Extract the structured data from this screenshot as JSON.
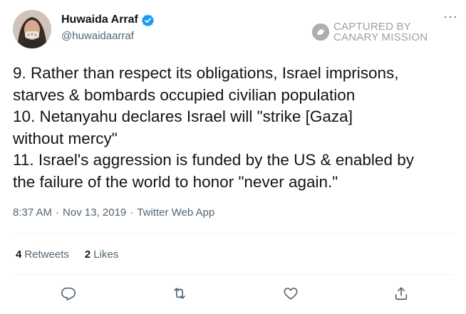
{
  "author": {
    "display_name": "Huwaida Arraf",
    "handle": "@huwaidaarraf",
    "verified": true
  },
  "more_label": "···",
  "watermark": {
    "line1": "CAPTURED BY",
    "line2": "CANARY MISSION"
  },
  "tweet": {
    "lines": [
      "9. Rather than respect its obligations, Israel imprisons,",
      "starves & bombards occupied civilian population",
      "10. Netanyahu declares Israel will \"strike [Gaza]",
      "without mercy\"",
      "11. Israel's aggression is funded by the US & enabled by",
      "the failure of the world to honor \"never again.\""
    ]
  },
  "meta": {
    "time": "8:37 AM",
    "sep1": "·",
    "date": "Nov 13, 2019",
    "sep2": "·",
    "source": "Twitter Web App"
  },
  "stats": {
    "retweets_count": "4",
    "retweets_label": "Retweets",
    "likes_count": "2",
    "likes_label": "Likes"
  },
  "actions": {
    "icons": [
      "reply-icon",
      "retweet-icon",
      "like-icon",
      "share-icon"
    ]
  },
  "colors": {
    "text_primary": "#0f1419",
    "text_secondary": "#536471",
    "verified_blue": "#1d9bf0",
    "watermark_gray": "#9aa1a8",
    "divider": "#eff3f4"
  }
}
